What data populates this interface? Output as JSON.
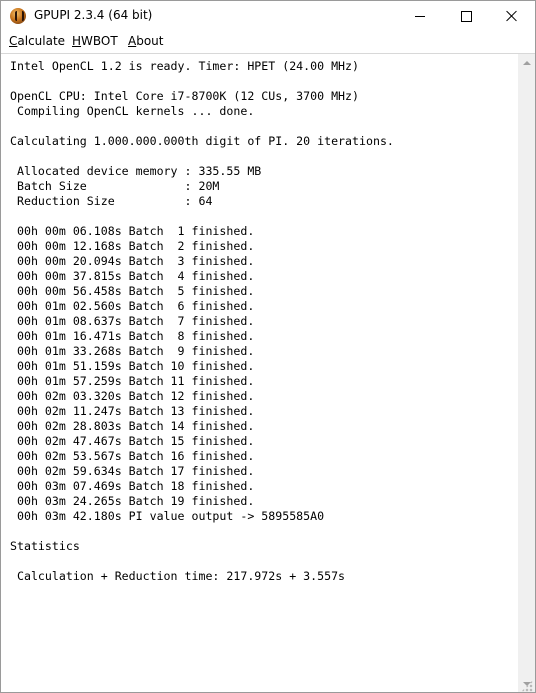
{
  "window": {
    "title": "GPUPI 2.3.4 (64 bit)"
  },
  "menu": {
    "calculate": {
      "accel": "C",
      "rest": "alculate"
    },
    "hwbot": {
      "accel": "H",
      "rest": "WBOT"
    },
    "about": {
      "accel": "A",
      "rest": "bout"
    }
  },
  "console": {
    "lines": [
      "Intel OpenCL 1.2 is ready. Timer: HPET (24.00 MHz)",
      "",
      "OpenCL CPU: Intel Core i7-8700K (12 CUs, 3700 MHz)",
      " Compiling OpenCL kernels ... done.",
      "",
      "Calculating 1.000.000.000th digit of PI. 20 iterations.",
      "",
      " Allocated device memory : 335.55 MB",
      " Batch Size              : 20M",
      " Reduction Size          : 64",
      "",
      " 00h 00m 06.108s Batch  1 finished.",
      " 00h 00m 12.168s Batch  2 finished.",
      " 00h 00m 20.094s Batch  3 finished.",
      " 00h 00m 37.815s Batch  4 finished.",
      " 00h 00m 56.458s Batch  5 finished.",
      " 00h 01m 02.560s Batch  6 finished.",
      " 00h 01m 08.637s Batch  7 finished.",
      " 00h 01m 16.471s Batch  8 finished.",
      " 00h 01m 33.268s Batch  9 finished.",
      " 00h 01m 51.159s Batch 10 finished.",
      " 00h 01m 57.259s Batch 11 finished.",
      " 00h 02m 03.320s Batch 12 finished.",
      " 00h 02m 11.247s Batch 13 finished.",
      " 00h 02m 28.803s Batch 14 finished.",
      " 00h 02m 47.467s Batch 15 finished.",
      " 00h 02m 53.567s Batch 16 finished.",
      " 00h 02m 59.634s Batch 17 finished.",
      " 00h 03m 07.469s Batch 18 finished.",
      " 00h 03m 24.265s Batch 19 finished.",
      " 00h 03m 42.180s PI value output -> 5895585A0",
      "",
      "Statistics",
      "",
      " Calculation + Reduction time: 217.972s + 3.557s"
    ]
  }
}
